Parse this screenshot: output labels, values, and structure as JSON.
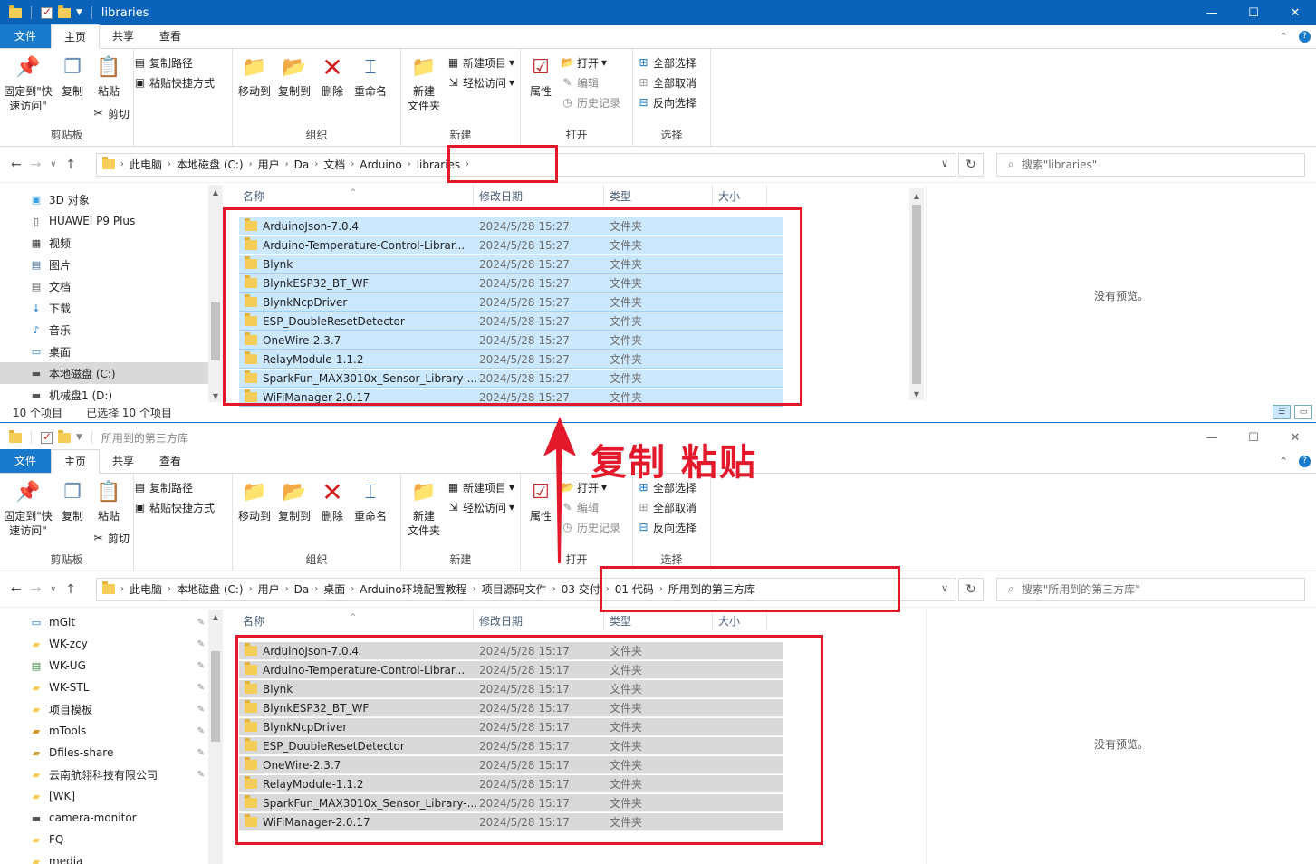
{
  "win1": {
    "title": "libraries",
    "tabs": [
      "文件",
      "主页",
      "共享",
      "查看"
    ],
    "ribbon": {
      "clipboard": {
        "pin": "固定到\"快\n速访问\"",
        "copy": "复制",
        "paste": "粘贴",
        "copy_path": "复制路径",
        "paste_shortcut": "粘贴快捷方式",
        "cut": "剪切",
        "label": "剪贴板"
      },
      "organize": {
        "move_to": "移动到",
        "copy_to": "复制到",
        "delete": "删除",
        "rename": "重命名",
        "label": "组织"
      },
      "new": {
        "new_folder": "新建\n文件夹",
        "new_item": "新建项目",
        "easy_access": "轻松访问",
        "label": "新建"
      },
      "open": {
        "properties": "属性",
        "open": "打开",
        "edit": "编辑",
        "history": "历史记录",
        "label": "打开"
      },
      "select": {
        "select_all": "全部选择",
        "select_none": "全部取消",
        "invert": "反向选择",
        "label": "选择"
      }
    },
    "breadcrumb": [
      "此电脑",
      "本地磁盘 (C:)",
      "用户",
      "Da",
      "文档",
      "Arduino",
      "libraries"
    ],
    "search_placeholder": "搜索\"libraries\"",
    "nav": [
      {
        "label": "3D 对象",
        "icon": "cube-icon"
      },
      {
        "label": "HUAWEI P9 Plus",
        "icon": "phone-icon"
      },
      {
        "label": "视频",
        "icon": "video-icon"
      },
      {
        "label": "图片",
        "icon": "picture-icon"
      },
      {
        "label": "文档",
        "icon": "document-icon"
      },
      {
        "label": "下载",
        "icon": "download-icon"
      },
      {
        "label": "音乐",
        "icon": "music-icon"
      },
      {
        "label": "桌面",
        "icon": "desktop-icon"
      },
      {
        "label": "本地磁盘 (C:)",
        "icon": "drive-icon"
      },
      {
        "label": "机械盘1 (D:)",
        "icon": "drive-icon"
      }
    ],
    "columns": {
      "name": "名称",
      "date": "修改日期",
      "type": "类型",
      "size": "大小"
    },
    "files": [
      {
        "name": "ArduinoJson-7.0.4",
        "date": "2024/5/28 15:27",
        "type": "文件夹"
      },
      {
        "name": "Arduino-Temperature-Control-Librar...",
        "date": "2024/5/28 15:27",
        "type": "文件夹"
      },
      {
        "name": "Blynk",
        "date": "2024/5/28 15:27",
        "type": "文件夹"
      },
      {
        "name": "BlynkESP32_BT_WF",
        "date": "2024/5/28 15:27",
        "type": "文件夹"
      },
      {
        "name": "BlynkNcpDriver",
        "date": "2024/5/28 15:27",
        "type": "文件夹"
      },
      {
        "name": "ESP_DoubleResetDetector",
        "date": "2024/5/28 15:27",
        "type": "文件夹"
      },
      {
        "name": "OneWire-2.3.7",
        "date": "2024/5/28 15:27",
        "type": "文件夹"
      },
      {
        "name": "RelayModule-1.1.2",
        "date": "2024/5/28 15:27",
        "type": "文件夹"
      },
      {
        "name": "SparkFun_MAX3010x_Sensor_Library-...",
        "date": "2024/5/28 15:27",
        "type": "文件夹"
      },
      {
        "name": "WiFiManager-2.0.17",
        "date": "2024/5/28 15:27",
        "type": "文件夹"
      }
    ],
    "preview": "没有预览。",
    "status": {
      "count": "10 个项目",
      "selected": "已选择 10 个项目"
    }
  },
  "win2": {
    "title": "所用到的第三方库",
    "tabs": [
      "文件",
      "主页",
      "共享",
      "查看"
    ],
    "breadcrumb": [
      "此电脑",
      "本地磁盘 (C:)",
      "用户",
      "Da",
      "桌面",
      "Arduino环境配置教程",
      "项目源码文件",
      "03 交付",
      "01 代码",
      "所用到的第三方库"
    ],
    "search_placeholder": "搜索\"所用到的第三方库\"",
    "nav": [
      {
        "label": "mGit",
        "icon": "desktop-icon"
      },
      {
        "label": "WK-zcy",
        "icon": "folder-icon"
      },
      {
        "label": "WK-UG",
        "icon": "image-icon"
      },
      {
        "label": "WK-STL",
        "icon": "folder-icon"
      },
      {
        "label": "项目模板",
        "icon": "folder-icon"
      },
      {
        "label": "mTools",
        "icon": "tools-icon"
      },
      {
        "label": "Dfiles-share",
        "icon": "shared-folder-icon"
      },
      {
        "label": "云南航翎科技有限公司",
        "icon": "folder-icon"
      },
      {
        "label": "[WK]",
        "icon": "folder-icon"
      },
      {
        "label": "camera-monitor",
        "icon": "drive-icon"
      },
      {
        "label": "FQ",
        "icon": "folder-icon"
      },
      {
        "label": "media",
        "icon": "folder-icon"
      }
    ],
    "files": [
      {
        "name": "ArduinoJson-7.0.4",
        "date": "2024/5/28 15:17",
        "type": "文件夹"
      },
      {
        "name": "Arduino-Temperature-Control-Librar...",
        "date": "2024/5/28 15:17",
        "type": "文件夹"
      },
      {
        "name": "Blynk",
        "date": "2024/5/28 15:17",
        "type": "文件夹"
      },
      {
        "name": "BlynkESP32_BT_WF",
        "date": "2024/5/28 15:17",
        "type": "文件夹"
      },
      {
        "name": "BlynkNcpDriver",
        "date": "2024/5/28 15:17",
        "type": "文件夹"
      },
      {
        "name": "ESP_DoubleResetDetector",
        "date": "2024/5/28 15:17",
        "type": "文件夹"
      },
      {
        "name": "OneWire-2.3.7",
        "date": "2024/5/28 15:17",
        "type": "文件夹"
      },
      {
        "name": "RelayModule-1.1.2",
        "date": "2024/5/28 15:17",
        "type": "文件夹"
      },
      {
        "name": "SparkFun_MAX3010x_Sensor_Library-...",
        "date": "2024/5/28 15:17",
        "type": "文件夹"
      },
      {
        "name": "WiFiManager-2.0.17",
        "date": "2024/5/28 15:17",
        "type": "文件夹"
      }
    ],
    "preview": "没有预览。"
  },
  "annotation": "复制 粘贴",
  "colors": {
    "accent": "#0a63b8",
    "file_tab": "#1979ca",
    "selection": "#cce8ff",
    "annotation": "#e3192b",
    "folder": "#f4cd58"
  }
}
